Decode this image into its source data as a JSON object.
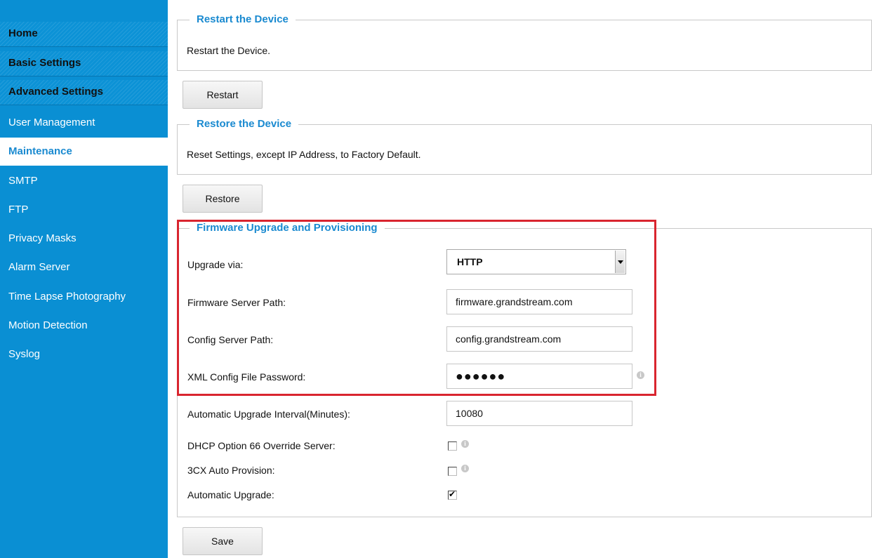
{
  "sidebar": {
    "headers": [
      {
        "label": "Home"
      },
      {
        "label": "Basic Settings"
      },
      {
        "label": "Advanced Settings"
      }
    ],
    "items": [
      {
        "label": "User Management",
        "active": false
      },
      {
        "label": "Maintenance",
        "active": true
      },
      {
        "label": "SMTP",
        "active": false
      },
      {
        "label": "FTP",
        "active": false
      },
      {
        "label": "Privacy Masks",
        "active": false
      },
      {
        "label": "Alarm Server",
        "active": false
      },
      {
        "label": "Time Lapse Photography",
        "active": false
      },
      {
        "label": "Motion Detection",
        "active": false
      },
      {
        "label": "Syslog",
        "active": false
      }
    ]
  },
  "restart": {
    "legend": "Restart the Device",
    "description": "Restart the Device.",
    "button_label": "Restart"
  },
  "restore": {
    "legend": "Restore the Device",
    "description": "Reset Settings, except IP Address, to Factory Default.",
    "button_label": "Restore"
  },
  "firmware": {
    "legend": "Firmware Upgrade and Provisioning",
    "upgrade_via_label": "Upgrade via:",
    "upgrade_via_value": "HTTP",
    "firmware_path_label": "Firmware Server Path:",
    "firmware_path_value": "firmware.grandstream.com",
    "config_path_label": "Config Server Path:",
    "config_path_value": "config.grandstream.com",
    "xml_password_label": "XML Config File Password:",
    "xml_password_value": "●●●●●●",
    "interval_label": "Automatic Upgrade Interval(Minutes):",
    "interval_value": "10080",
    "dhcp66_label": "DHCP Option 66 Override Server:",
    "dhcp66_checked": false,
    "cx_label": "3CX Auto Provision:",
    "cx_checked": false,
    "auto_upgrade_label": "Automatic Upgrade:",
    "auto_upgrade_checked": true
  },
  "save_label": "Save",
  "colors": {
    "sidebar": "#0a8fd3",
    "accent_text": "#1a8ad0",
    "highlight": "#d9252f"
  }
}
